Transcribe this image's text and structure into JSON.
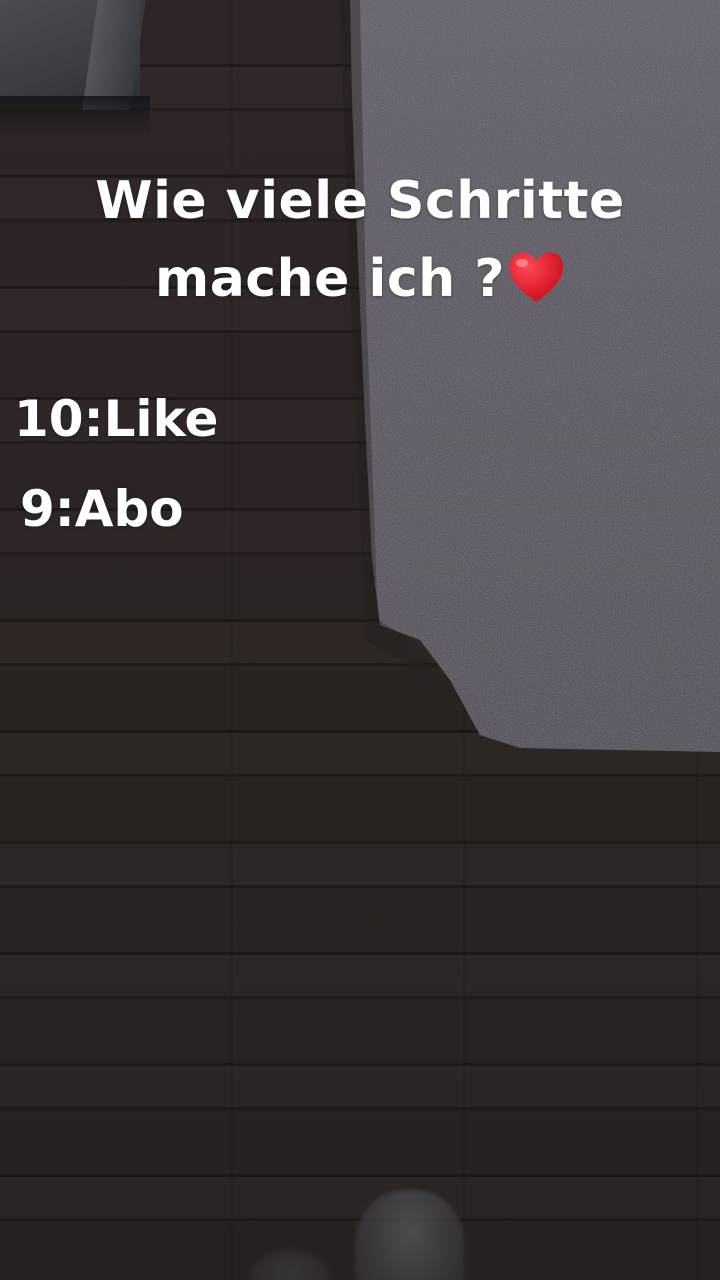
{
  "overlay": {
    "title_line_1": "Wie viele Schritte",
    "title_line_2": "mache ich ?",
    "title_icon": "red-heart-icon",
    "items": [
      {
        "label": "10:Like"
      },
      {
        "label": "9:Abo"
      }
    ]
  },
  "colors": {
    "text": "#ffffff",
    "heart": "#e0202f",
    "floor": "#2a2421",
    "carpet": "#4b4650"
  }
}
